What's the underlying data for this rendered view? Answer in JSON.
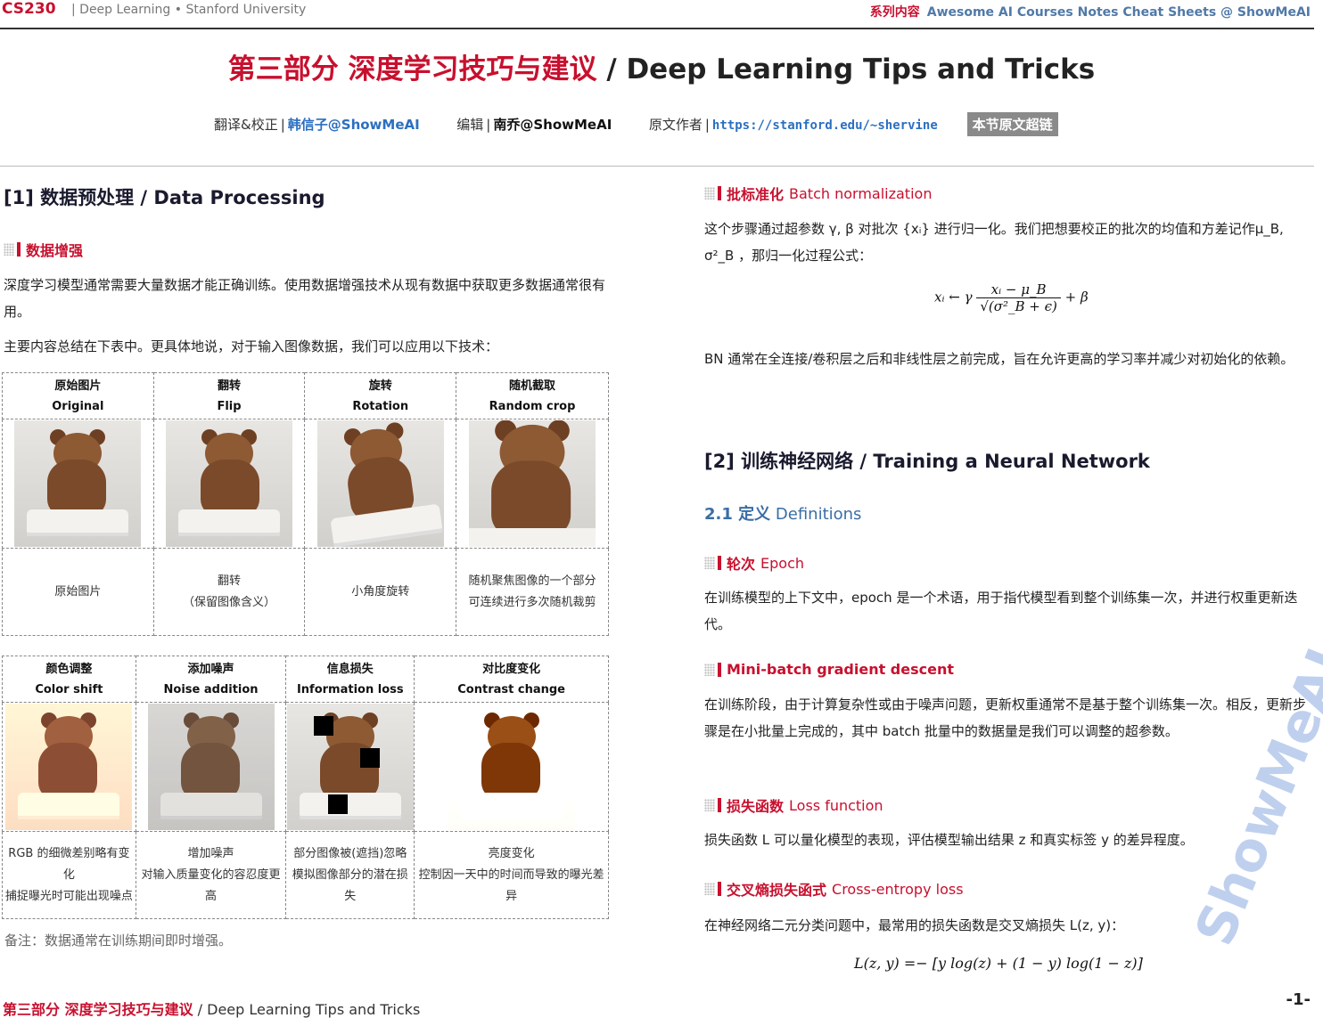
{
  "header": {
    "course": "CS230",
    "course_sub": "| Deep Learning • Stanford University",
    "series_label": "系列内容",
    "series_value": "Awesome AI Courses Notes Cheat Sheets @ ShowMeAI"
  },
  "title": {
    "zh": "第三部分 深度学习技巧与建议",
    "en": " / Deep Learning Tips and Tricks"
  },
  "credits": {
    "translate_label": "翻译&校正",
    "translate_name": "韩信子@ShowMeAI",
    "edit_label": "编辑",
    "edit_name": "南乔@ShowMeAI",
    "author_label": "原文作者",
    "author_link": "https://stanford.edu/~shervine",
    "source_button": "本节原文超链"
  },
  "left": {
    "section_title": "[1] 数据预处理 / Data Processing",
    "aug_heading": "数据增强",
    "para1": "深度学习模型通常需要大量数据才能正确训练。使用数据增强技术从现有数据中获取更多数据通常很有用。",
    "para2": "主要内容总结在下表中。更具体地说，对于输入图像数据，我们可以应用以下技术：",
    "table1": {
      "headers": [
        {
          "zh": "原始图片",
          "en": "Original"
        },
        {
          "zh": "翻转",
          "en": "Flip"
        },
        {
          "zh": "旋转",
          "en": "Rotation"
        },
        {
          "zh": "随机截取",
          "en": "Random crop"
        }
      ],
      "captions": [
        "原始图片",
        "翻转\n（保留图像含义）",
        "小角度旋转",
        "随机聚焦图像的一个部分\n可连续进行多次随机裁剪"
      ]
    },
    "table2": {
      "headers": [
        {
          "zh": "颜色调整",
          "en": "Color shift"
        },
        {
          "zh": "添加噪声",
          "en": "Noise addition"
        },
        {
          "zh": "信息损失",
          "en": "Information loss"
        },
        {
          "zh": "对比度变化",
          "en": "Contrast change"
        }
      ],
      "captions": [
        "RGB 的细微差别略有变化\n捕捉曝光时可能出现噪点",
        "增加噪声\n对输入质量变化的容忍度更高",
        "部分图像被(遮挡)忽略\n模拟图像部分的潜在损失",
        "亮度变化\n控制因一天中的时间而导致的曝光差异"
      ]
    },
    "note": "备注：数据通常在训练期间即时增强。"
  },
  "right": {
    "bn_heading_zh": "批标准化",
    "bn_heading_en": "Batch normalization",
    "bn_para": "这个步骤通过超参数 γ, β 对批次 {xᵢ} 进行归一化。我们把想要校正的批次的均值和方差记作μ_B, σ²_B ，那归一化过程公式：",
    "bn_formula_lhs": "xᵢ ← γ",
    "bn_formula_num": "xᵢ − μ_B",
    "bn_formula_den": "√(σ²_B + ϵ)",
    "bn_formula_rhs": "+ β",
    "bn_para2": "BN 通常在全连接/卷积层之后和非线性层之前完成，旨在允许更高的学习率并减少对初始化的依赖。",
    "section2_title": "[2] 训练神经网络 / Training a Neural Network",
    "sub21": "2.1 定义",
    "sub21_en": "Definitions",
    "epoch_heading_zh": "轮次",
    "epoch_heading_en": "Epoch",
    "epoch_para": "在训练模型的上下文中，epoch 是一个术语，用于指代模型看到整个训练集一次，并进行权重更新迭代。",
    "mb_heading": "Mini-batch gradient descent",
    "mb_para": "在训练阶段，由于计算复杂性或由于噪声问题，更新权重通常不是基于整个训练集一次。相反，更新步骤是在小批量上完成的，其中 batch 批量中的数据量是我们可以调整的超参数。",
    "loss_heading_zh": "损失函数",
    "loss_heading_en": "Loss function",
    "loss_para": "损失函数 L 可以量化模型的表现，评估模型输出结果 z 和真实标签 y 的差异程度。",
    "ce_heading_zh": "交叉熵损失函式",
    "ce_heading_en": "Cross-entropy loss",
    "ce_para": "在神经网络二元分类问题中，最常用的损失函数是交叉熵损失 L(z, y)：",
    "ce_formula": "L(z, y) =− [y log(z) + (1 − y) log(1 − z)]"
  },
  "watermark": "ShowMeAI",
  "footer": {
    "zh": "第三部分 深度学习技巧与建议",
    "en": " / Deep Learning Tips and Tricks",
    "page": "-1-"
  }
}
